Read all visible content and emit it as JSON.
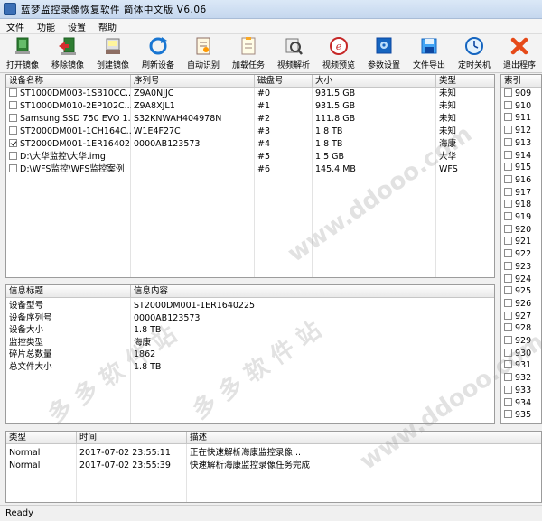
{
  "window": {
    "title": "蓝梦监控录像恢复软件  简体中文版  V6.06"
  },
  "menu": [
    "文件",
    "功能",
    "设置",
    "帮助"
  ],
  "toolbar": [
    {
      "label": "打开镜像",
      "icon": "open-image-icon"
    },
    {
      "label": "移除镜像",
      "icon": "remove-image-icon"
    },
    {
      "label": "创建镜像",
      "icon": "create-image-icon"
    },
    {
      "label": "刷新设备",
      "icon": "refresh-icon"
    },
    {
      "label": "自动识别",
      "icon": "auto-detect-icon"
    },
    {
      "label": "加载任务",
      "icon": "load-task-icon"
    },
    {
      "label": "视频解析",
      "icon": "video-analyze-icon"
    },
    {
      "label": "视频预览",
      "icon": "video-preview-icon"
    },
    {
      "label": "参数设置",
      "icon": "settings-icon"
    },
    {
      "label": "文件导出",
      "icon": "save-export-icon"
    },
    {
      "label": "定时关机",
      "icon": "clock-icon"
    },
    {
      "label": "退出程序",
      "icon": "exit-icon"
    }
  ],
  "devices": {
    "headers": [
      "设备名称",
      "序列号",
      "磁盘号",
      "大小",
      "类型"
    ],
    "rows": [
      {
        "checked": false,
        "name": "ST1000DM003-1SB10CC...",
        "serial": "Z9A0NJJC",
        "disk": "#0",
        "size": "931.5 GB",
        "type": "未知"
      },
      {
        "checked": false,
        "name": "ST1000DM010-2EP102C...",
        "serial": "Z9A8XJL1",
        "disk": "#1",
        "size": "931.5 GB",
        "type": "未知"
      },
      {
        "checked": false,
        "name": "Samsung SSD 750 EVO 1...",
        "serial": "S32KNWAH404978N",
        "disk": "#2",
        "size": "111.8 GB",
        "type": "未知"
      },
      {
        "checked": false,
        "name": "ST2000DM001-1CH164C...",
        "serial": "W1E4F27C",
        "disk": "#3",
        "size": "1.8 TB",
        "type": "未知"
      },
      {
        "checked": true,
        "name": "ST2000DM001-1ER16402...",
        "serial": "0000AB123573",
        "disk": "#4",
        "size": "1.8 TB",
        "type": "海康"
      },
      {
        "checked": false,
        "name": "D:\\大华监控\\大华.img",
        "serial": "",
        "disk": "#5",
        "size": "1.5 GB",
        "type": "大华"
      },
      {
        "checked": false,
        "name": "D:\\WFS监控\\WFS监控案例",
        "serial": "",
        "disk": "#6",
        "size": "145.4 MB",
        "type": "WFS"
      }
    ]
  },
  "info": {
    "headers": [
      "信息标题",
      "信息内容"
    ],
    "rows": [
      {
        "key": "设备型号",
        "value": "ST2000DM001-1ER1640225"
      },
      {
        "key": "设备序列号",
        "value": "0000AB123573"
      },
      {
        "key": "设备大小",
        "value": "1.8 TB"
      },
      {
        "key": "监控类型",
        "value": "海康"
      },
      {
        "key": "碎片总数量",
        "value": "1862"
      },
      {
        "key": "总文件大小",
        "value": "1.8 TB"
      }
    ]
  },
  "index": {
    "header": "索引",
    "items": [
      "909",
      "910",
      "911",
      "912",
      "913",
      "914",
      "915",
      "916",
      "917",
      "918",
      "919",
      "920",
      "921",
      "922",
      "923",
      "924",
      "925",
      "926",
      "927",
      "928",
      "929",
      "930",
      "931",
      "932",
      "933",
      "934",
      "935"
    ]
  },
  "log": {
    "headers": [
      "类型",
      "时间",
      "描述"
    ],
    "rows": [
      {
        "type": "Normal",
        "time": "2017-07-02 23:55:11",
        "desc": "正在快速解析海康监控录像..."
      },
      {
        "type": "Normal",
        "time": "2017-07-02 23:55:39",
        "desc": "快速解析海康监控录像任务完成"
      }
    ]
  },
  "status": "Ready",
  "watermarks": [
    "多 多 软 件 站",
    "www.ddooo.com"
  ]
}
